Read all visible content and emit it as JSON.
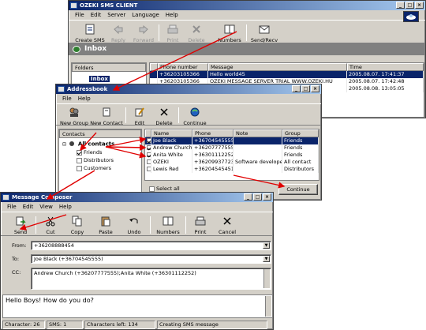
{
  "main": {
    "title": "OZEKI SMS CLIENT",
    "menu": [
      "File",
      "Edit",
      "Server",
      "Language",
      "Help"
    ],
    "toolbar": [
      {
        "label": "Create SMS",
        "icon": "create-sms-icon",
        "enabled": true
      },
      {
        "label": "Reply",
        "icon": "reply-icon",
        "enabled": false
      },
      {
        "label": "Forward",
        "icon": "forward-icon",
        "enabled": false
      },
      {
        "label": "Print",
        "icon": "print-icon",
        "enabled": false
      },
      {
        "label": "Delete",
        "icon": "delete-icon",
        "enabled": false
      },
      {
        "label": "Numbers",
        "icon": "numbers-icon",
        "enabled": true
      },
      {
        "label": "Send/Recv",
        "icon": "send-recv-icon",
        "enabled": true
      }
    ],
    "folder_bar_title": "Inbox",
    "folders_label": "Folders",
    "folder_items": [
      "Inbox"
    ],
    "columns": [
      "Phone number",
      "Message",
      "Time"
    ],
    "rows": [
      {
        "phone": "+36203105366",
        "message": "Hello world45",
        "time": "2005.08.07. 17:41:37"
      },
      {
        "phone": "+36203105366",
        "message": "OZEKI MESSAGE SERVER TRIAL WWW.OZEKI.HU",
        "time": "2005.08.07. 17:42:48"
      },
      {
        "phone": "",
        "message": "",
        "time": "2005.08.08. 13:05:05"
      }
    ]
  },
  "addressbook": {
    "title": "Addressbook",
    "menu": [
      "File",
      "Help"
    ],
    "toolbar": [
      {
        "label": "New Group",
        "icon": "new-group-icon"
      },
      {
        "label": "New Contact",
        "icon": "new-contact-icon"
      },
      {
        "label": "Edit",
        "icon": "edit-icon"
      },
      {
        "label": "Delete",
        "icon": "delete-icon"
      },
      {
        "label": "Continue",
        "icon": "continue-icon"
      }
    ],
    "contacts_label": "Contacts",
    "tree_root": "All contacts",
    "tree_items": [
      {
        "label": "Friends",
        "checked": true
      },
      {
        "label": "Distributors",
        "checked": false
      },
      {
        "label": "Customers",
        "checked": false
      }
    ],
    "columns": [
      "Name",
      "Phone",
      "Note",
      "Group"
    ],
    "rows": [
      {
        "name": "Joe Black",
        "phone": "+36704545555",
        "note": "",
        "group": "Friends",
        "checked": true,
        "selected": true
      },
      {
        "name": "Andrew Church",
        "phone": "+36207777555",
        "note": "",
        "group": "Friends",
        "checked": true,
        "selected": false
      },
      {
        "name": "Anita White",
        "phone": "+36301112252",
        "note": "",
        "group": "Friends",
        "checked": true,
        "selected": false
      },
      {
        "name": "OZEKI",
        "phone": "+36209937723",
        "note": "Software developer",
        "group": "All contact",
        "checked": false,
        "selected": false
      },
      {
        "name": "Lewis Red",
        "phone": "+36204545451",
        "note": "",
        "group": "Distributors",
        "checked": false,
        "selected": false
      }
    ],
    "select_all_label": "Select all",
    "continue_button": "Continue"
  },
  "composer": {
    "title": "Message Composer",
    "menu": [
      "File",
      "Edit",
      "View",
      "Help"
    ],
    "toolbar": [
      {
        "label": "Send",
        "icon": "send-icon"
      },
      {
        "label": "Cut",
        "icon": "cut-icon"
      },
      {
        "label": "Copy",
        "icon": "copy-icon"
      },
      {
        "label": "Paste",
        "icon": "paste-icon"
      },
      {
        "label": "Undo",
        "icon": "undo-icon"
      },
      {
        "label": "Numbers",
        "icon": "numbers-icon"
      },
      {
        "label": "Print",
        "icon": "print-icon"
      },
      {
        "label": "Cancel",
        "icon": "cancel-icon"
      }
    ],
    "from_label": "From:",
    "from_value": "+36208888454",
    "to_label": "To:",
    "to_value": "Joe Black (+36704545555)",
    "cc_label": "CC:",
    "cc_value": "Andrew Church (+36207777555);Anita White (+36301112252)",
    "message": "Hello Boys! How do you do?",
    "status": [
      "Character: 26",
      "SMS: 1",
      "Characters left: 134",
      "Creating SMS message"
    ]
  },
  "colors": {
    "arrow": "#e00000",
    "title_start": "#0a246a",
    "title_end": "#a6caf0",
    "selection": "#0a246a"
  }
}
